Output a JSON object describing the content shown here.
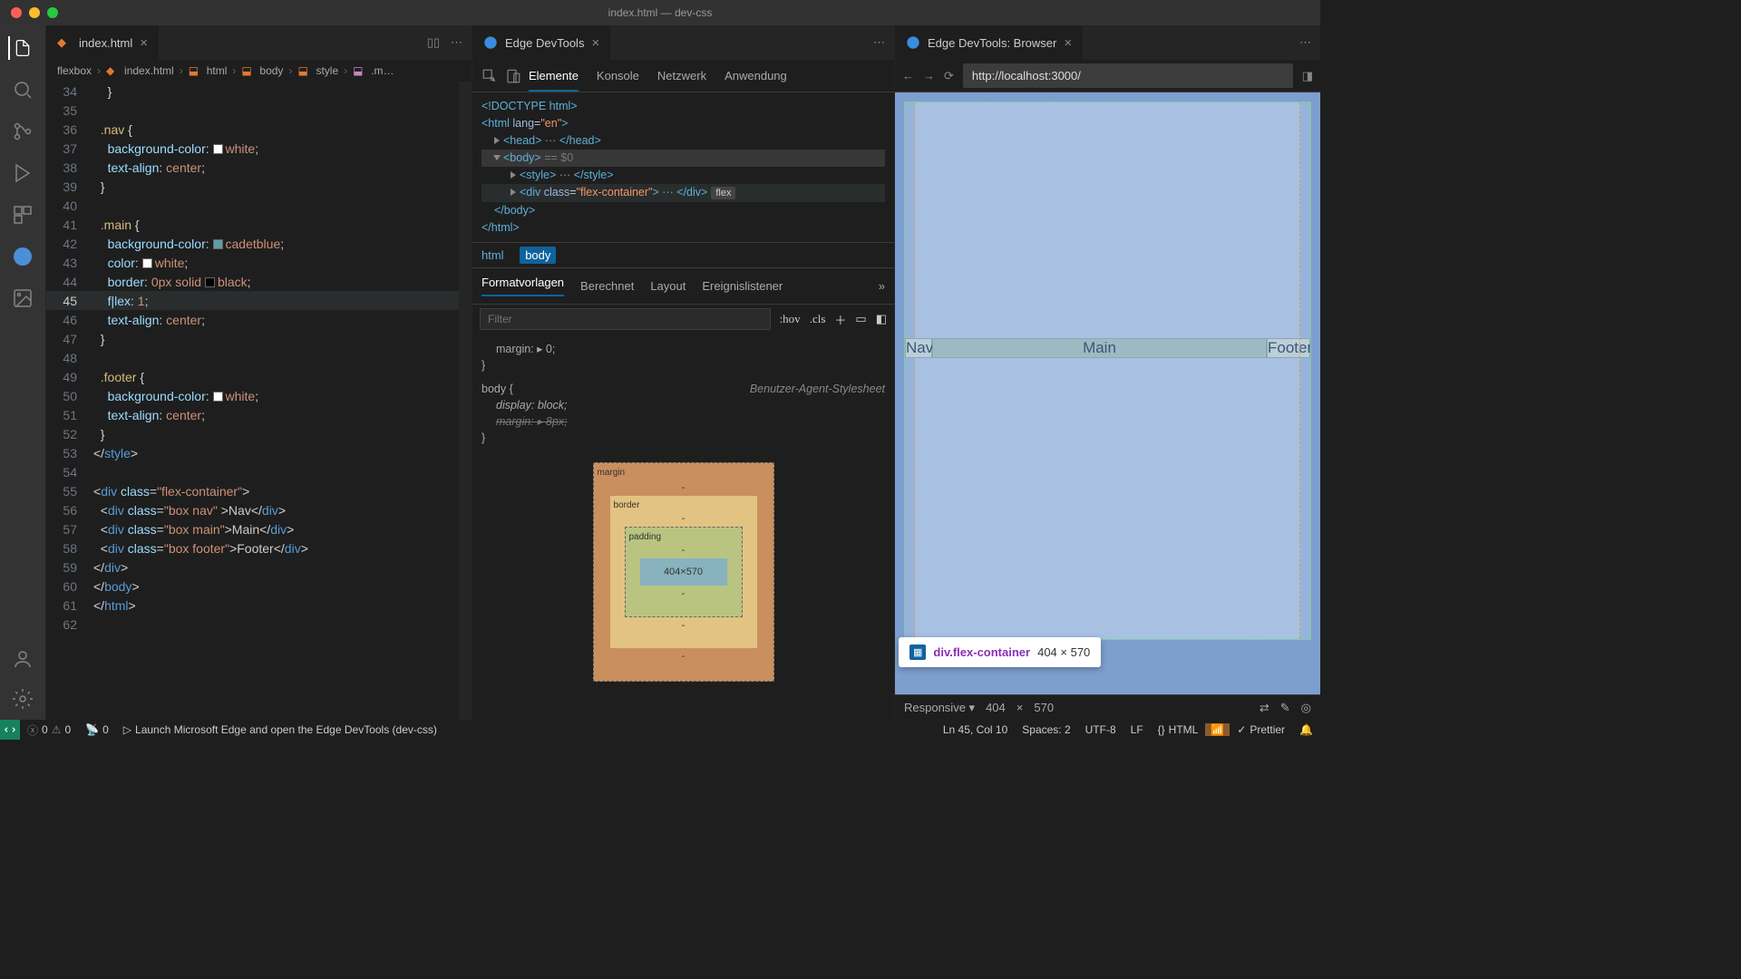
{
  "window_title": "index.html — dev-css",
  "tabs": {
    "file": {
      "name": "index.html"
    },
    "devtools": {
      "name": "Edge DevTools"
    },
    "browser": {
      "name": "Edge DevTools: Browser"
    }
  },
  "breadcrumb": [
    "flexbox",
    "index.html",
    "html",
    "body",
    "style",
    ".m…"
  ],
  "editor_lines": [
    {
      "n": 34,
      "html": "    <span class='punc'>}</span>"
    },
    {
      "n": 35,
      "html": ""
    },
    {
      "n": 36,
      "html": "  <span class='sel'>.nav</span> <span class='punc'>{</span>"
    },
    {
      "n": 37,
      "html": "    <span class='prop'>background-color</span>: <span class='swatch' style='background:#fff'></span><span class='val'>white</span>;"
    },
    {
      "n": 38,
      "html": "    <span class='prop'>text-align</span>: <span class='val'>center</span>;"
    },
    {
      "n": 39,
      "html": "  <span class='punc'>}</span>"
    },
    {
      "n": 40,
      "html": ""
    },
    {
      "n": 41,
      "html": "  <span class='sel'>.main</span> <span class='punc'>{</span>"
    },
    {
      "n": 42,
      "html": "    <span class='prop'>background-color</span>: <span class='swatch' style='background:#5f9ea0'></span><span class='val'>cadetblue</span>;"
    },
    {
      "n": 43,
      "html": "    <span class='prop'>color</span>: <span class='swatch' style='background:#fff'></span><span class='val'>white</span>;"
    },
    {
      "n": 44,
      "html": "    <span class='prop'>border</span>: <span class='val'>0px solid</span> <span class='swatch' style='background:#000'></span><span class='val'>black</span>;"
    },
    {
      "n": 45,
      "html": "    <span class='prop'>f|lex</span>: <span class='val'>1</span>;",
      "active": true
    },
    {
      "n": 46,
      "html": "    <span class='prop'>text-align</span>: <span class='val'>center</span>;"
    },
    {
      "n": 47,
      "html": "  <span class='punc'>}</span>"
    },
    {
      "n": 48,
      "html": ""
    },
    {
      "n": 49,
      "html": "  <span class='sel'>.footer</span> <span class='punc'>{</span>"
    },
    {
      "n": 50,
      "html": "    <span class='prop'>background-color</span>: <span class='swatch' style='background:#fff'></span><span class='val'>white</span>;"
    },
    {
      "n": 51,
      "html": "    <span class='prop'>text-align</span>: <span class='val'>center</span>;"
    },
    {
      "n": 52,
      "html": "  <span class='punc'>}</span>"
    },
    {
      "n": 53,
      "html": "<span class='punc'>&lt;/</span><span class='tag'>style</span><span class='punc'>&gt;</span>"
    },
    {
      "n": 54,
      "html": ""
    },
    {
      "n": 55,
      "html": "<span class='punc'>&lt;</span><span class='tag'>div</span> <span class='attr'>class</span>=<span class='str'>\"flex-container\"</span><span class='punc'>&gt;</span>"
    },
    {
      "n": 56,
      "html": "  <span class='punc'>&lt;</span><span class='tag'>div</span> <span class='attr'>class</span>=<span class='str'>\"box nav\"</span> <span class='punc'>&gt;</span>Nav<span class='punc'>&lt;/</span><span class='tag'>div</span><span class='punc'>&gt;</span>"
    },
    {
      "n": 57,
      "html": "  <span class='punc'>&lt;</span><span class='tag'>div</span> <span class='attr'>class</span>=<span class='str'>\"box main\"</span><span class='punc'>&gt;</span>Main<span class='punc'>&lt;/</span><span class='tag'>div</span><span class='punc'>&gt;</span>"
    },
    {
      "n": 58,
      "html": "  <span class='punc'>&lt;</span><span class='tag'>div</span> <span class='attr'>class</span>=<span class='str'>\"box footer\"</span><span class='punc'>&gt;</span>Footer<span class='punc'>&lt;/</span><span class='tag'>div</span><span class='punc'>&gt;</span>"
    },
    {
      "n": 59,
      "html": "<span class='punc'>&lt;/</span><span class='tag'>div</span><span class='punc'>&gt;</span>"
    },
    {
      "n": 60,
      "html": "<span class='punc'>&lt;/</span><span class='tag'>body</span><span class='punc'>&gt;</span>"
    },
    {
      "n": 61,
      "html": "<span class='punc'>&lt;/</span><span class='tag'>html</span><span class='punc'>&gt;</span>"
    },
    {
      "n": 62,
      "html": ""
    }
  ],
  "devtools": {
    "tabs": [
      "Elemente",
      "Konsole",
      "Netzwerk",
      "Anwendung"
    ],
    "dom": [
      "<!DOCTYPE html>",
      "<html lang=\"en\">",
      "  ▸ <head>…</head>",
      "  ▾ <body> == $0",
      "    ▸ <style>…</style>",
      "    ▸ <div class=\"flex-container\">…</div> flex",
      "    </body>",
      "</html>"
    ],
    "crumb": [
      "html",
      "body"
    ],
    "style_tabs": [
      "Formatvorlagen",
      "Berechnet",
      "Layout",
      "Ereignislistener"
    ],
    "filter_ph": "Filter",
    "toggles": [
      ":hov",
      ".cls"
    ],
    "rules": {
      "r1": "margin: ▸ 0;",
      "r2_sel": "body {",
      "r2_src": "Benutzer-Agent-Stylesheet",
      "r2_1": "display: block;",
      "r2_2": "margin: ▸ 8px;"
    },
    "box": {
      "margin": "margin",
      "border": "border",
      "padding": "padding",
      "size": "404×570"
    }
  },
  "browser": {
    "url": "http://localhost:3000/",
    "tooltip_sel": "div.flex-container",
    "tooltip_dim": "404 × 570",
    "nav": "Nav",
    "main": "Main",
    "footer": "Footer",
    "resp": "Responsive",
    "w": "404",
    "h": "570"
  },
  "status": {
    "err": "0",
    "warn": "0",
    "port": "0",
    "launch": "Launch Microsoft Edge and open the Edge DevTools (dev-css)",
    "ln": "Ln 45, Col 10",
    "spaces": "Spaces: 2",
    "enc": "UTF-8",
    "eol": "LF",
    "lang": "HTML",
    "prettier": "Prettier"
  }
}
